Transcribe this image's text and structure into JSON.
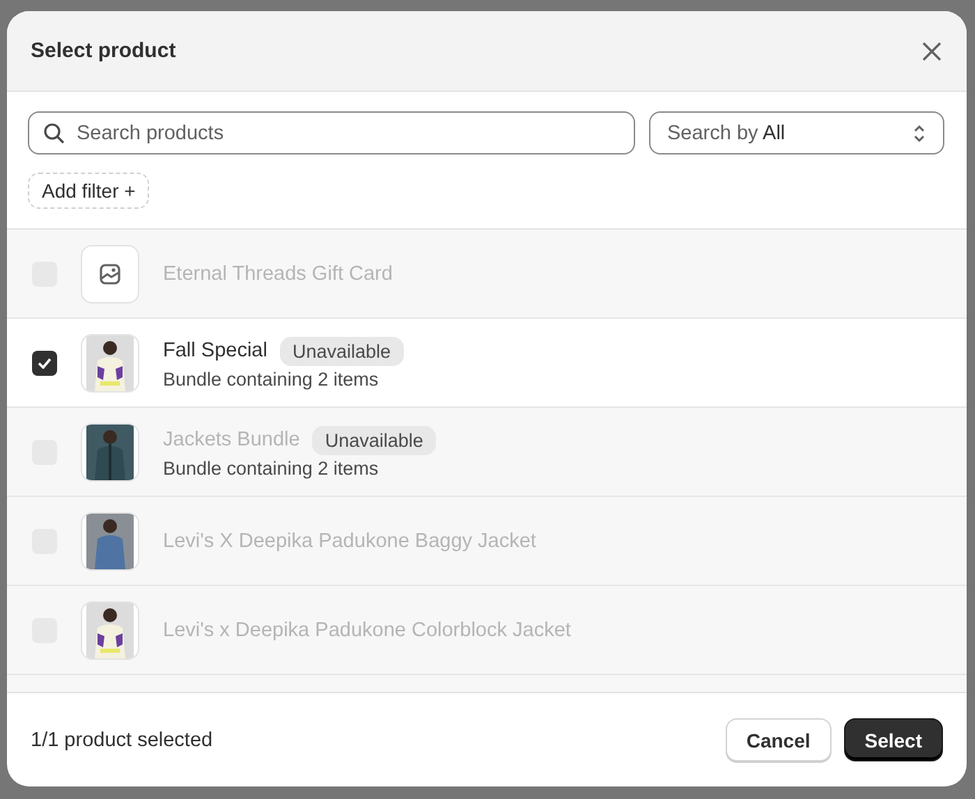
{
  "dialog": {
    "title": "Select product"
  },
  "search": {
    "placeholder": "Search products",
    "scope_label": "Search by",
    "scope_value": "All"
  },
  "filter_button": {
    "label": "Add filter +"
  },
  "products": [
    {
      "kind": "placeholder",
      "title": "Eternal Threads Gift Card",
      "checked": false,
      "disabled": true
    },
    {
      "kind": "picture",
      "title": "Fall Special",
      "badge": "Unavailable",
      "subtitle": "Bundle containing 2 items",
      "checked": true,
      "disabled": false
    },
    {
      "kind": "picture",
      "title": "Jackets Bundle",
      "badge": "Unavailable",
      "subtitle": "Bundle containing 2 items",
      "checked": false,
      "disabled": true
    },
    {
      "kind": "picture",
      "title": "Levi's X Deepika Padukone Baggy Jacket",
      "checked": false,
      "disabled": true
    },
    {
      "kind": "picture",
      "title": "Levi's x Deepika Padukone Colorblock Jacket",
      "checked": false,
      "disabled": true
    }
  ],
  "footer": {
    "status": "1/1 product selected",
    "buttons": [
      {
        "label": "Cancel",
        "kind": "secondary"
      },
      {
        "label": "Select",
        "kind": "primary"
      }
    ]
  }
}
